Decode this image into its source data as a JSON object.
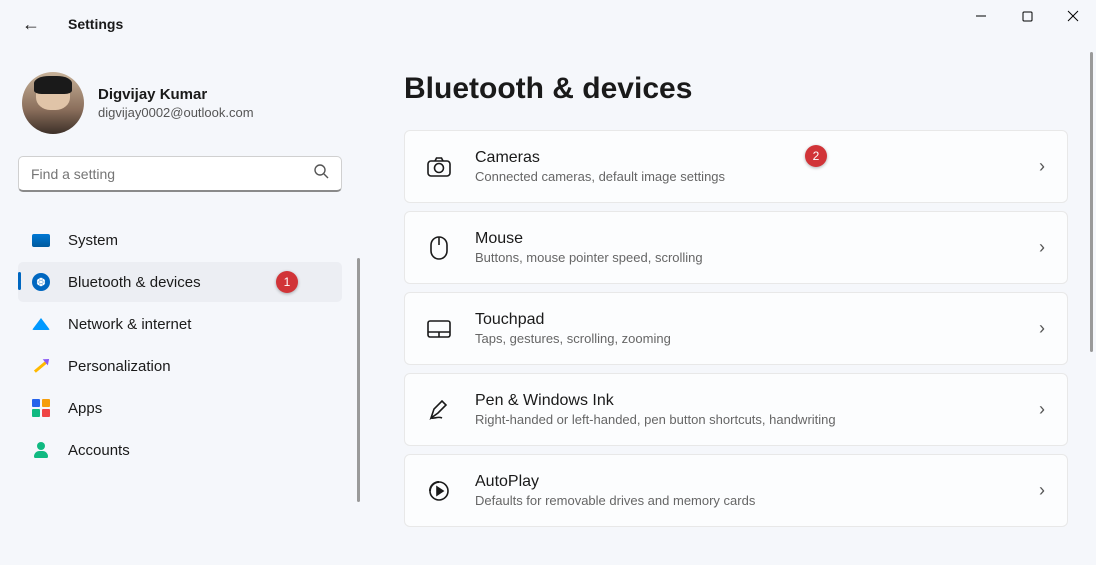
{
  "app": {
    "title": "Settings"
  },
  "profile": {
    "name": "Digvijay Kumar",
    "email": "digvijay0002@outlook.com"
  },
  "search": {
    "placeholder": "Find a setting"
  },
  "sidebar": {
    "items": [
      {
        "label": "System"
      },
      {
        "label": "Bluetooth & devices"
      },
      {
        "label": "Network & internet"
      },
      {
        "label": "Personalization"
      },
      {
        "label": "Apps"
      },
      {
        "label": "Accounts"
      }
    ],
    "badge_value": "1"
  },
  "page": {
    "title": "Bluetooth & devices"
  },
  "cards": [
    {
      "title": "Cameras",
      "sub": "Connected cameras, default image settings",
      "badge": "2"
    },
    {
      "title": "Mouse",
      "sub": "Buttons, mouse pointer speed, scrolling"
    },
    {
      "title": "Touchpad",
      "sub": "Taps, gestures, scrolling, zooming"
    },
    {
      "title": "Pen & Windows Ink",
      "sub": "Right-handed or left-handed, pen button shortcuts, handwriting"
    },
    {
      "title": "AutoPlay",
      "sub": "Defaults for removable drives and memory cards"
    }
  ]
}
